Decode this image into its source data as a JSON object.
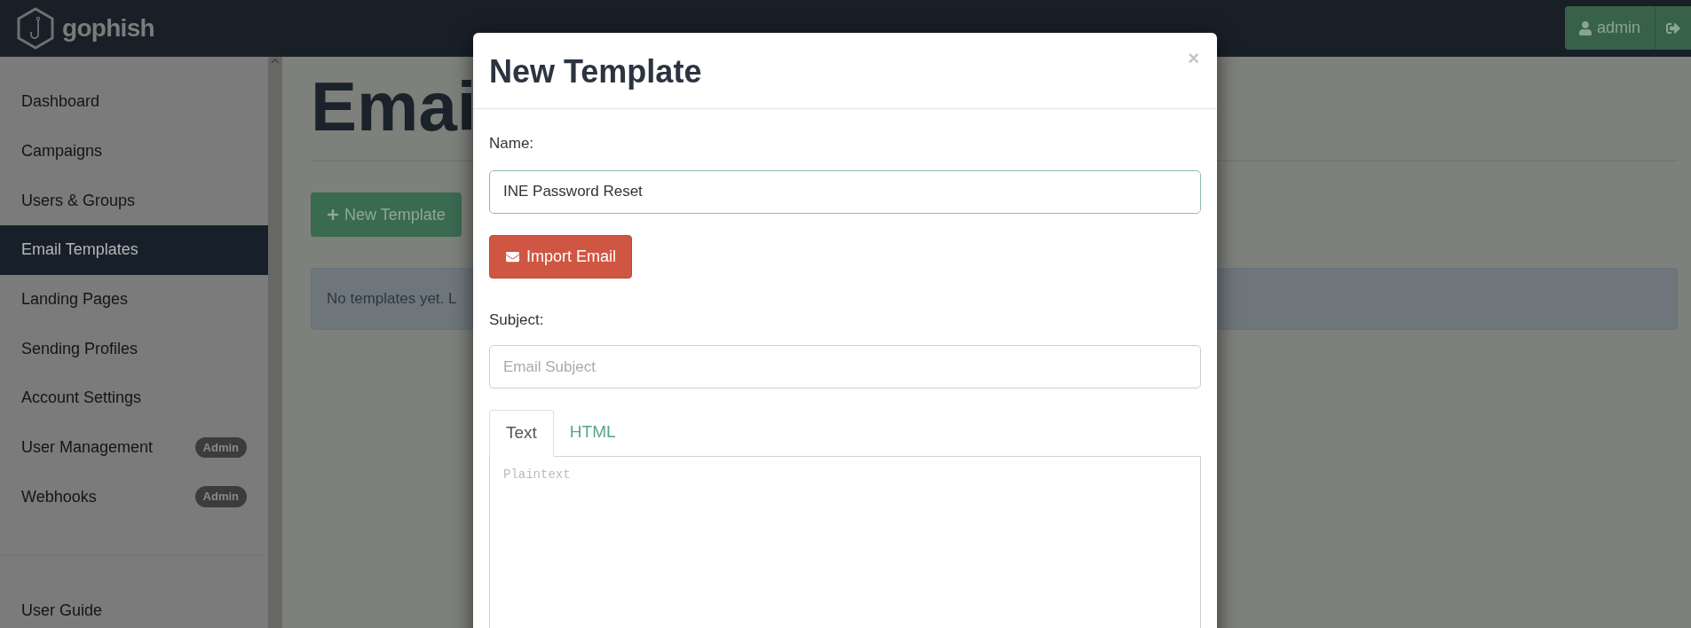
{
  "header": {
    "brand": "gophish",
    "user_button": "admin"
  },
  "sidebar": {
    "items": [
      {
        "label": "Dashboard",
        "selected": false
      },
      {
        "label": "Campaigns",
        "selected": false
      },
      {
        "label": "Users & Groups",
        "selected": false
      },
      {
        "label": "Email Templates",
        "selected": true
      },
      {
        "label": "Landing Pages",
        "selected": false
      },
      {
        "label": "Sending Profiles",
        "selected": false
      },
      {
        "label": "Account Settings",
        "selected": false
      },
      {
        "label": "User Management",
        "selected": false,
        "badge": "Admin"
      },
      {
        "label": "Webhooks",
        "selected": false,
        "badge": "Admin"
      }
    ],
    "footer_items": [
      {
        "label": "User Guide"
      }
    ]
  },
  "main": {
    "title": "Emai",
    "new_button": "New Template",
    "alert": "No templates yet. L"
  },
  "modal": {
    "title": "New Template",
    "close": "×",
    "name_label": "Name:",
    "name_value": "INE Password Reset",
    "import_button": "Import Email",
    "subject_label": "Subject:",
    "subject_placeholder": "Email Subject",
    "tabs": [
      {
        "label": "Text",
        "selected": true
      },
      {
        "label": "HTML",
        "selected": false
      }
    ],
    "body_placeholder": "Plaintext"
  }
}
